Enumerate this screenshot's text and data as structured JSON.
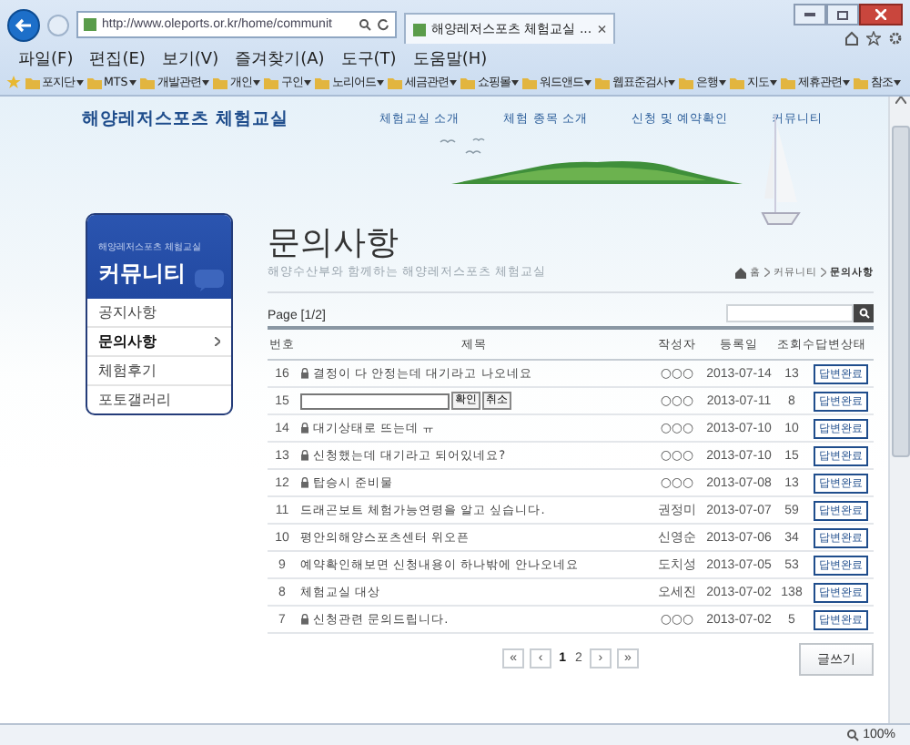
{
  "browser": {
    "address": "http://www.oleports.or.kr/home/communit",
    "tab_title": "해양레저스포츠 체험교실 ...",
    "tab_close": "×",
    "menu": [
      "파일(F)",
      "편집(E)",
      "보기(V)",
      "즐겨찾기(A)",
      "도구(T)",
      "도움말(H)"
    ],
    "favorites": [
      "포지단",
      "MTS",
      "개발관련",
      "개인",
      "구인",
      "노리어드",
      "세금관련",
      "쇼핑몰",
      "워드앤드",
      "웹표준검사",
      "은행",
      "지도",
      "제휴관련",
      "참조"
    ]
  },
  "site": {
    "title": "해양레저스포츠 체험교실",
    "nav": [
      "체험교실 소개",
      "체험 종목 소개",
      "신청 및 예약확인",
      "커뮤니티"
    ]
  },
  "sidebar": {
    "caption": "해양레저스포츠 체험교실",
    "title": "커뮤니티",
    "items": [
      {
        "label": "공지사항",
        "selected": false
      },
      {
        "label": "문의사항",
        "selected": true
      },
      {
        "label": "체험후기",
        "selected": false
      },
      {
        "label": "포토갤러리",
        "selected": false
      }
    ]
  },
  "page": {
    "heading": "문의사항",
    "subtitle": "해양수산부와 함께하는 해양레저스포츠 체험교실",
    "breadcrumb": [
      "홈",
      "커뮤니티",
      "문의사항"
    ],
    "page_info": "Page [1/2]"
  },
  "table": {
    "columns": [
      "번호",
      "제목",
      "작성자",
      "등록일",
      "조회수",
      "답변상태"
    ],
    "rows": [
      {
        "kind": "post",
        "number": "16",
        "locked": true,
        "title": "결정이 다 안정는데 대기라고 나오네요",
        "author": "○○○",
        "date": "2013-07-14",
        "views": "13",
        "status": "답변완료"
      },
      {
        "kind": "edit",
        "number": "15",
        "buttons": [
          "확인",
          "취소"
        ],
        "author": "○○○",
        "date": "2013-07-11",
        "views": "8",
        "status": "답변완료"
      },
      {
        "kind": "post",
        "number": "14",
        "locked": true,
        "title": "대기상태로 뜨는데 ㅠ",
        "author": "○○○",
        "date": "2013-07-10",
        "views": "10",
        "status": "답변완료"
      },
      {
        "kind": "post",
        "number": "13",
        "locked": true,
        "title": "신청했는데 대기라고 되어있네요?",
        "author": "○○○",
        "date": "2013-07-10",
        "views": "15",
        "status": "답변완료"
      },
      {
        "kind": "post",
        "number": "12",
        "locked": true,
        "title": "탑승시 준비물",
        "author": "○○○",
        "date": "2013-07-08",
        "views": "13",
        "status": "답변완료"
      },
      {
        "kind": "post",
        "number": "11",
        "locked": false,
        "title": "드래곤보트 체험가능연령을 알고 싶습니다.",
        "author": "권정미",
        "date": "2013-07-07",
        "views": "59",
        "status": "답변완료"
      },
      {
        "kind": "post",
        "number": "10",
        "locked": false,
        "title": "평안의해양스포츠센터 위오픈",
        "author": "신영순",
        "date": "2013-07-06",
        "views": "34",
        "status": "답변완료"
      },
      {
        "kind": "post",
        "number": "9",
        "locked": false,
        "title": "예약확인해보면 신청내용이 하나밖에 안나오네요",
        "author": "도치성",
        "date": "2013-07-05",
        "views": "53",
        "status": "답변완료"
      },
      {
        "kind": "post",
        "number": "8",
        "locked": false,
        "title": "체험교실 대상",
        "author": "오세진",
        "date": "2013-07-02",
        "views": "138",
        "status": "답변완료"
      },
      {
        "kind": "post",
        "number": "7",
        "locked": true,
        "title": "신청관련 문의드립니다.",
        "author": "○○○",
        "date": "2013-07-02",
        "views": "5",
        "status": "답변완료"
      }
    ]
  },
  "pagination": [
    {
      "kind": "nav",
      "label": "«"
    },
    {
      "kind": "nav",
      "label": "‹"
    },
    {
      "kind": "page",
      "label": "1",
      "selected": true
    },
    {
      "kind": "page",
      "label": "2",
      "selected": false
    },
    {
      "kind": "nav",
      "label": "›"
    },
    {
      "kind": "nav",
      "label": "»"
    }
  ],
  "write_button": "글쓰기",
  "status_bar": {
    "zoom": "100%"
  }
}
